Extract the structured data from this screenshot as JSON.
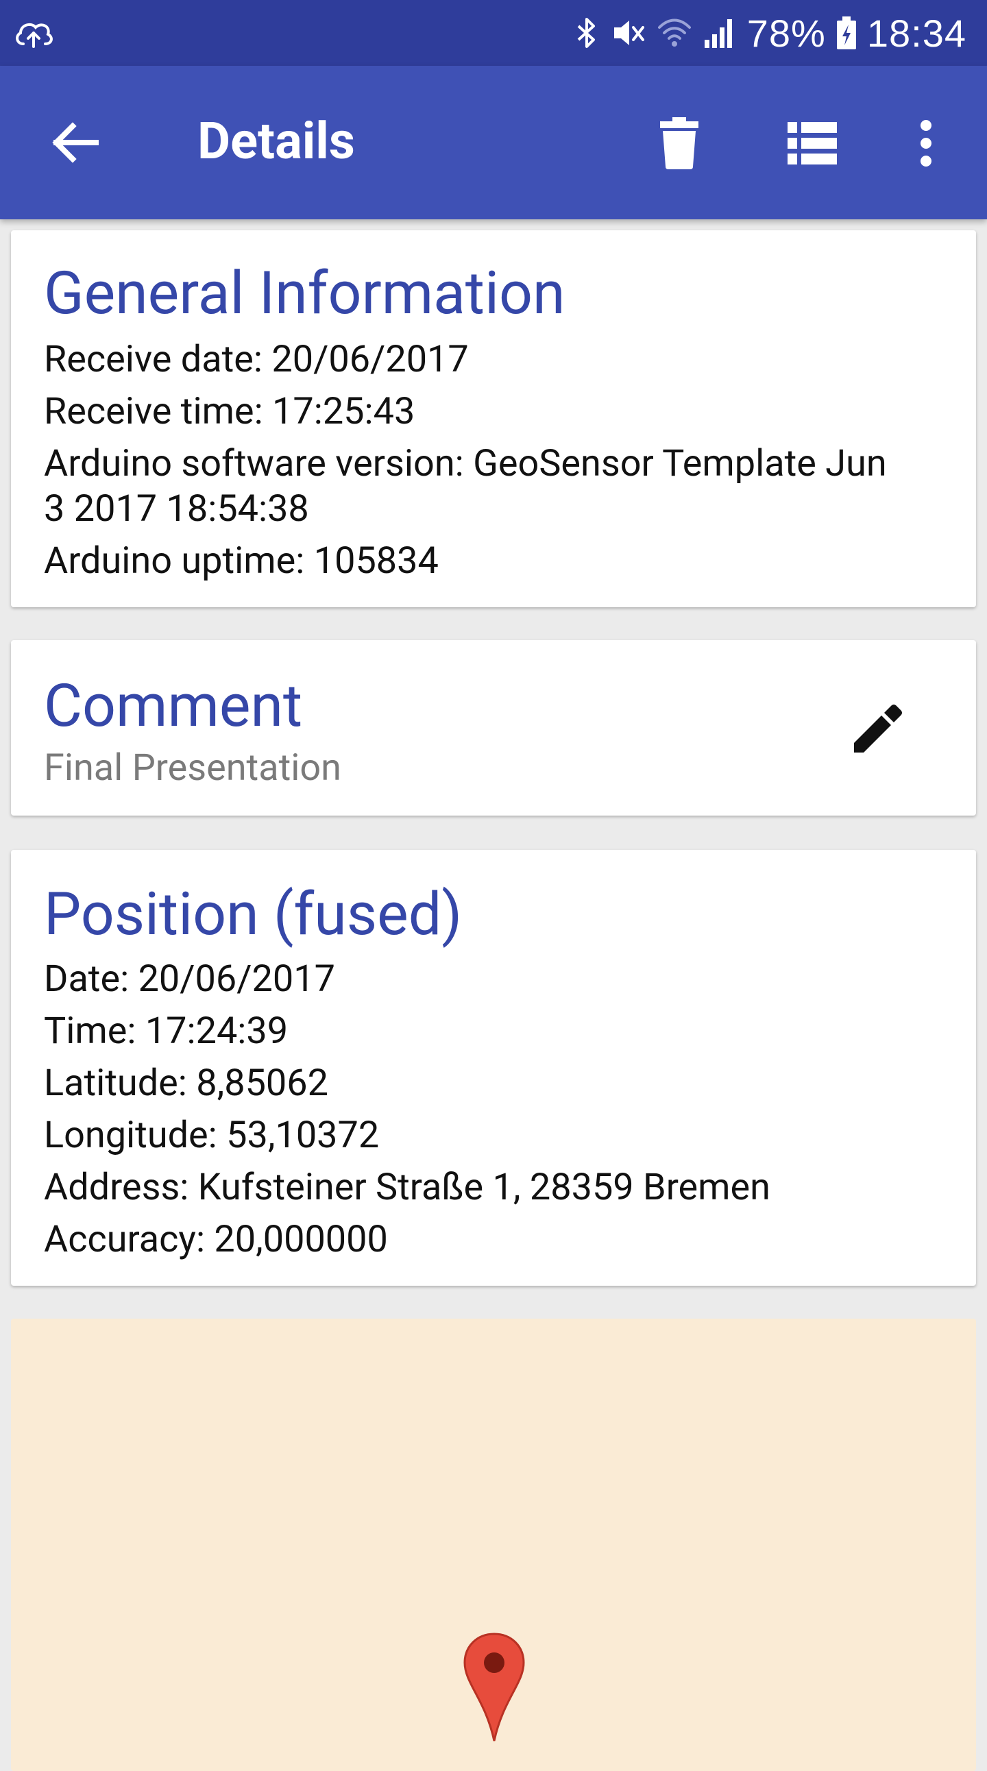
{
  "status_bar": {
    "battery": "78%",
    "time": "18:34",
    "icons": [
      "cloud-upload-icon",
      "bluetooth-icon",
      "mute-icon",
      "wifi-icon",
      "signal-icon",
      "battery-icon"
    ]
  },
  "app_bar": {
    "title": "Details",
    "icons": [
      "back-arrow-icon",
      "delete-icon",
      "list-icon",
      "more-vert-icon"
    ]
  },
  "general_info": {
    "title": "General Information",
    "receive_date": "Receive date: 20/06/2017",
    "receive_time": "Receive time: 17:25:43",
    "software_version_line1": "Arduino software version: GeoSensor Template Jun",
    "software_version_line2": "3 2017 18:54:38",
    "uptime": "Arduino uptime: 105834"
  },
  "comment": {
    "title": "Comment",
    "value": "Final Presentation",
    "edit_icon": "edit-pencil-icon"
  },
  "position": {
    "title": "Position (fused)",
    "date": "Date: 20/06/2017",
    "time": "Time: 17:24:39",
    "latitude": "Latitude: 8,85062",
    "longitude": "Longitude: 53,10372",
    "address": "Address: Kufsteiner Straße 1, 28359 Bremen",
    "accuracy": "Accuracy: 20,000000"
  },
  "map": {
    "background_color": "#faebd5",
    "marker_icon": "map-marker-icon",
    "marker_color": "#e74c3c"
  },
  "colors": {
    "status_bar": "#2f3d9b",
    "app_bar": "#3f51b5",
    "card_title": "#3547a8"
  }
}
